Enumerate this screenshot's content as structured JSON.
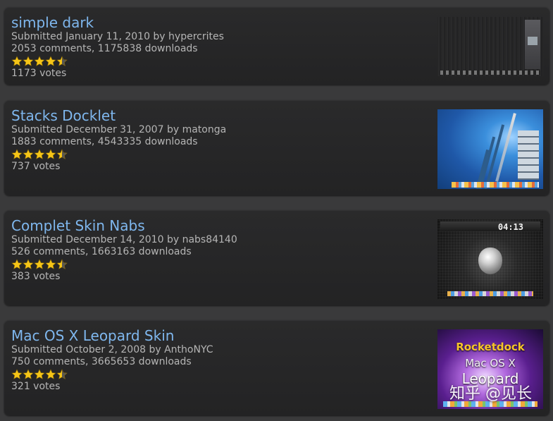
{
  "skins": [
    {
      "title": "simple dark",
      "submitted": "Submitted January 11, 2010 by hypercrites",
      "stats": "2053 comments, 1175838 downloads",
      "votes": "1173 votes",
      "rating": 4.5
    },
    {
      "title": "Stacks Docklet",
      "submitted": "Submitted December 31, 2007 by matonga",
      "stats": "1883 comments, 4543335 downloads",
      "votes": "737 votes",
      "rating": 4.5
    },
    {
      "title": "Complet Skin Nabs",
      "submitted": "Submitted December 14, 2010 by nabs84140",
      "stats": "526 comments, 1663163 downloads",
      "votes": "383 votes",
      "rating": 4.5,
      "thumb_clock": "04:13"
    },
    {
      "title": "Mac OS X Leopard Skin",
      "submitted": "Submitted October 2, 2008 by AnthoNYC",
      "stats": "750 comments, 3665653 downloads",
      "votes": "321 votes",
      "rating": 4.5,
      "thumb_lines": [
        "Rocketdock",
        "Mac OS X",
        "Leopard"
      ]
    }
  ],
  "watermark": "知乎 @见长",
  "colors": {
    "background": "#3a3a3b",
    "card": "#262627",
    "title": "#7fb7ee",
    "meta": "#b5b5b5",
    "star": "#f5c518"
  }
}
